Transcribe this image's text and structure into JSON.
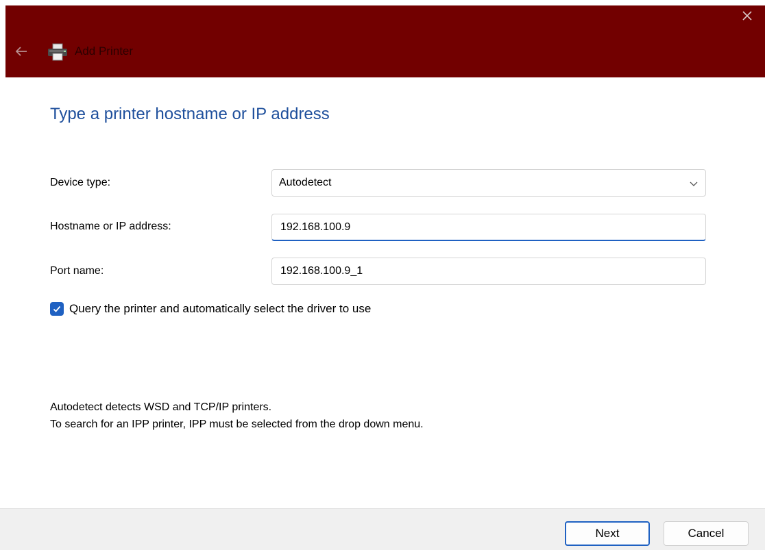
{
  "window": {
    "title": "Add Printer",
    "title_bar_color": "#720000",
    "close_icon": "close-icon",
    "back_icon": "back-arrow-icon",
    "app_icon": "printer-icon"
  },
  "main": {
    "heading": "Type a printer hostname or IP address",
    "device_type": {
      "label": "Device type:",
      "selected": "Autodetect"
    },
    "hostname": {
      "label": "Hostname or IP address:",
      "value": "192.168.100.9"
    },
    "port_name": {
      "label": "Port name:",
      "value": "192.168.100.9_1"
    },
    "query_checkbox": {
      "label": "Query the printer and automatically select the driver to use",
      "checked": true
    },
    "info": {
      "line1": "Autodetect detects WSD and TCP/IP printers.",
      "line2": "To search for an IPP printer, IPP must be selected from the drop down menu."
    }
  },
  "footer": {
    "next_label": "Next",
    "cancel_label": "Cancel"
  },
  "colors": {
    "accent": "#1f61c2",
    "heading": "#1e4f9c"
  }
}
